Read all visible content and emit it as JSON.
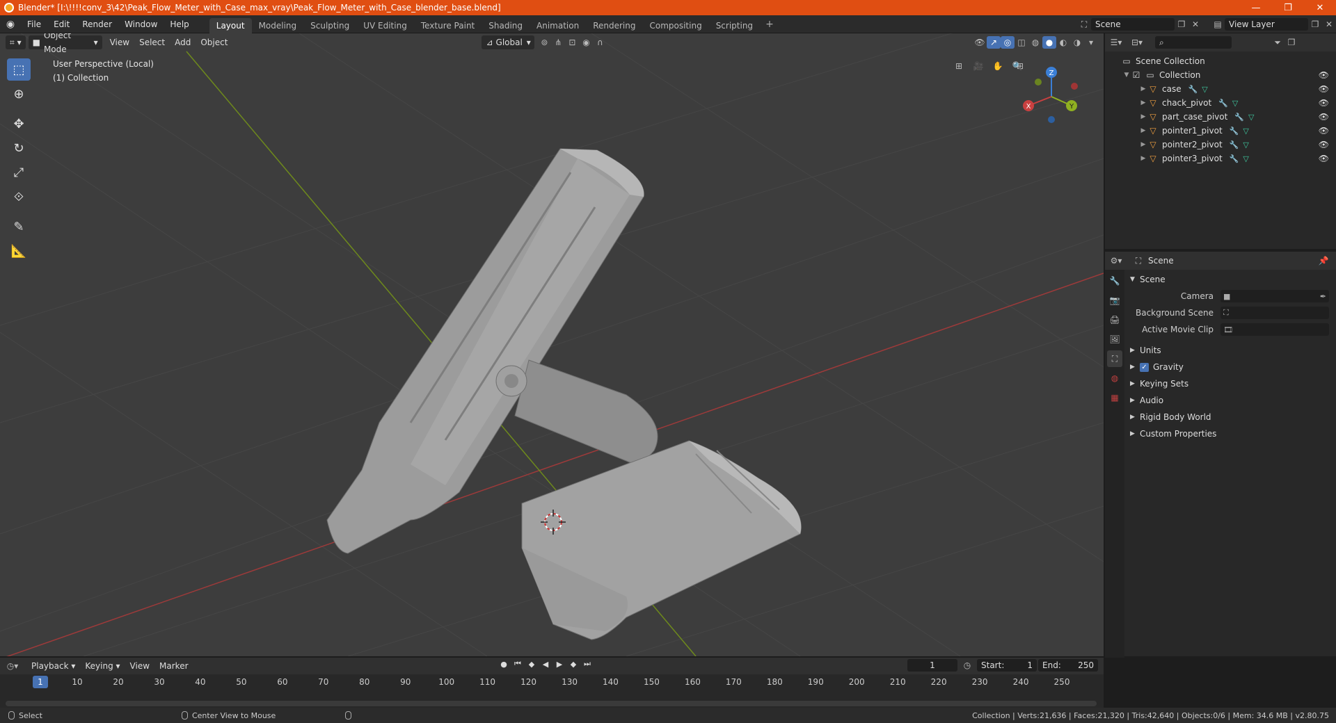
{
  "window": {
    "title": "Blender* [I:\\!!!!conv_3\\42\\Peak_Flow_Meter_with_Case_max_vray\\Peak_Flow_Meter_with_Case_blender_base.blend]",
    "minimize": "—",
    "restore": "❐",
    "close": "✕"
  },
  "menu": [
    "File",
    "Edit",
    "Render",
    "Window",
    "Help"
  ],
  "workspaces": [
    {
      "label": "Layout",
      "active": true
    },
    {
      "label": "Modeling"
    },
    {
      "label": "Sculpting"
    },
    {
      "label": "UV Editing"
    },
    {
      "label": "Texture Paint"
    },
    {
      "label": "Shading"
    },
    {
      "label": "Animation"
    },
    {
      "label": "Rendering"
    },
    {
      "label": "Compositing"
    },
    {
      "label": "Scripting"
    }
  ],
  "scene_selector": {
    "value": "Scene"
  },
  "view_layer": {
    "value": "View Layer"
  },
  "viewport": {
    "mode": "Object Mode",
    "menus": [
      "View",
      "Select",
      "Add",
      "Object"
    ],
    "transform_orientation": "Global",
    "info_line1": "User Perspective (Local)",
    "info_line2": "(1) Collection",
    "gizmo": {
      "x": "X",
      "y": "Y",
      "z": "Z"
    }
  },
  "outliner": {
    "root": "Scene Collection",
    "collection": "Collection",
    "items": [
      "case",
      "chack_pivot",
      "part_case_pivot",
      "pointer1_pivot",
      "pointer2_pivot",
      "pointer3_pivot"
    ]
  },
  "properties": {
    "header": "Scene",
    "section": "Scene",
    "fields": [
      {
        "label": "Camera"
      },
      {
        "label": "Background Scene"
      },
      {
        "label": "Active Movie Clip"
      }
    ],
    "panels": [
      "Units",
      "Gravity",
      "Keying Sets",
      "Audio",
      "Rigid Body World",
      "Custom Properties"
    ]
  },
  "timeline": {
    "menus": [
      "Playback",
      "Keying",
      "View",
      "Marker"
    ],
    "current_frame": "1",
    "start_label": "Start:",
    "start": "1",
    "end_label": "End:",
    "end": "250",
    "ticks": [
      "1",
      "10",
      "20",
      "30",
      "40",
      "50",
      "60",
      "70",
      "80",
      "90",
      "100",
      "110",
      "120",
      "130",
      "140",
      "150",
      "160",
      "170",
      "180",
      "190",
      "200",
      "210",
      "220",
      "230",
      "240",
      "250"
    ]
  },
  "statusbar": {
    "select": "Select",
    "center_view": "Center View to Mouse",
    "stats": "Collection | Verts:21,636 | Faces:21,320 | Tris:42,640 | Objects:0/6 | Mem: 34.6 MB | v2.80.75"
  },
  "colors": {
    "titlebar": "#e04e12",
    "accent": "#4772b3",
    "viewport_bg": "#3d3d3d",
    "axis_x": "#c94040",
    "axis_y": "#8fb021",
    "axis_z": "#3b7fd6"
  }
}
